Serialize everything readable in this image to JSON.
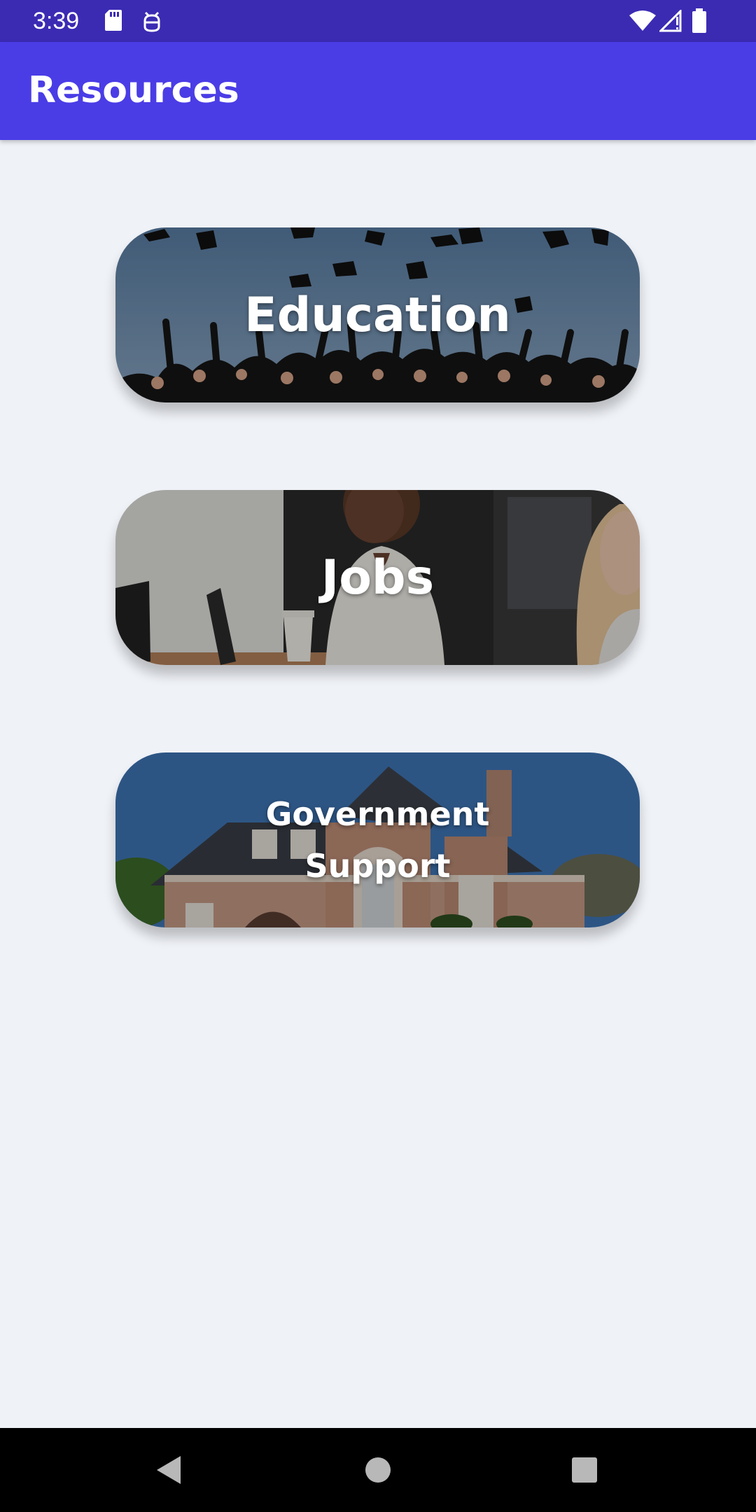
{
  "status_bar": {
    "time": "3:39",
    "icons": [
      "sd-card-icon",
      "android-debug-icon",
      "wifi-icon",
      "cell-signal-icon",
      "battery-icon"
    ]
  },
  "app_bar": {
    "title": "Resources",
    "color": "#4a3de6"
  },
  "cards": [
    {
      "label": "Education",
      "image": "graduation-caps-photo"
    },
    {
      "label": "Jobs",
      "image": "office-workers-photo"
    },
    {
      "label": "Government\nSupport",
      "image": "house-photo"
    }
  ],
  "nav_bar": {
    "buttons": [
      "back-icon",
      "home-icon",
      "recents-icon"
    ]
  }
}
